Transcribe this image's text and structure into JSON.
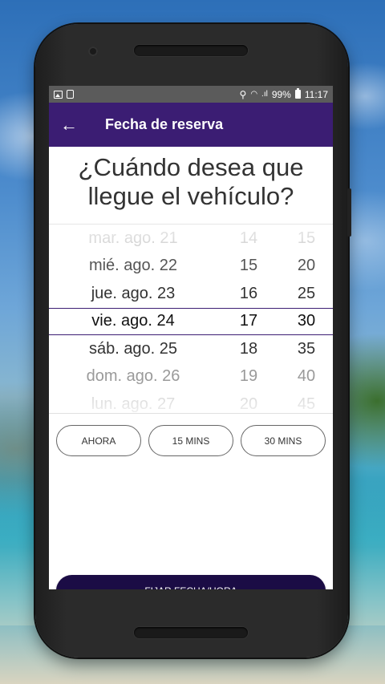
{
  "status_bar": {
    "battery": "99%",
    "time": "11:17"
  },
  "app_bar": {
    "title": "Fecha de reserva"
  },
  "question": "¿Cuándo desea que llegue el vehículo?",
  "picker": {
    "rows": [
      {
        "date": "mar. ago. 21",
        "hour": "14",
        "minute": "15"
      },
      {
        "date": "mié. ago. 22",
        "hour": "15",
        "minute": "20"
      },
      {
        "date": "jue. ago. 23",
        "hour": "16",
        "minute": "25"
      },
      {
        "date": "vie. ago. 24",
        "hour": "17",
        "minute": "30"
      },
      {
        "date": "sáb. ago. 25",
        "hour": "18",
        "minute": "35"
      },
      {
        "date": "dom. ago. 26",
        "hour": "19",
        "minute": "40"
      },
      {
        "date": "lun. ago. 27",
        "hour": "20",
        "minute": "45"
      }
    ],
    "selected_index": 3
  },
  "quick_buttons": {
    "now": "AHORA",
    "fifteen": "15 MINS",
    "thirty": "30 MINS"
  },
  "set_button": "FIJAR FECHA/HORA",
  "colors": {
    "primary": "#3b1d73",
    "button_dark": "#1b0c45",
    "status_bar": "#5b5b5b"
  }
}
